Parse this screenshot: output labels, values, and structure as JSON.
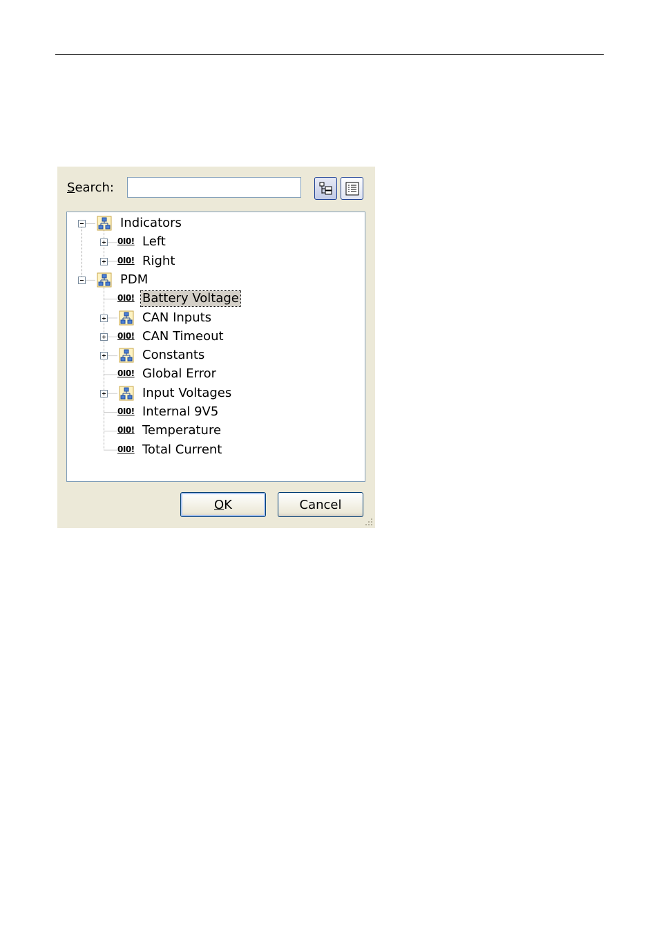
{
  "dialog": {
    "search": {
      "label_accel": "S",
      "label_rest": "earch:",
      "value": ""
    },
    "toolbar": {
      "tree_view_icon": "tree-view-icon",
      "list_view_icon": "list-view-icon"
    },
    "tree": {
      "nodes": [
        {
          "label": "Indicators",
          "icon": "group-icon",
          "expander": "minus",
          "level": 0
        },
        {
          "label": "Left",
          "icon": "binary-icon",
          "icon_text": "0I0!",
          "expander": "plus",
          "level": 1
        },
        {
          "label": "Right",
          "icon": "binary-icon",
          "icon_text": "0I0!",
          "expander": "plus",
          "level": 1
        },
        {
          "label": "PDM",
          "icon": "group-icon",
          "expander": "minus",
          "level": 0
        },
        {
          "label": "Battery Voltage",
          "icon": "binary-icon",
          "icon_text": "0I0!",
          "expander": "none",
          "level": 1,
          "selected": true
        },
        {
          "label": "CAN Inputs",
          "icon": "group-icon",
          "expander": "plus",
          "level": 1
        },
        {
          "label": "CAN Timeout",
          "icon": "binary-icon",
          "icon_text": "0I0!",
          "expander": "plus",
          "level": 1
        },
        {
          "label": "Constants",
          "icon": "group-icon",
          "expander": "plus",
          "level": 1
        },
        {
          "label": "Global Error",
          "icon": "binary-icon",
          "icon_text": "0I0!",
          "expander": "none",
          "level": 1
        },
        {
          "label": "Input Voltages",
          "icon": "group-icon",
          "expander": "plus",
          "level": 1
        },
        {
          "label": "Internal 9V5",
          "icon": "binary-icon",
          "icon_text": "0I0!",
          "expander": "none",
          "level": 1
        },
        {
          "label": "Temperature",
          "icon": "binary-icon",
          "icon_text": "0I0!",
          "expander": "none",
          "level": 1
        },
        {
          "label": "Total Current",
          "icon": "binary-icon",
          "icon_text": "0I0!",
          "expander": "none",
          "level": 1
        }
      ]
    },
    "buttons": {
      "ok_accel": "O",
      "ok_rest": "K",
      "cancel": "Cancel"
    }
  },
  "colors": {
    "dialog_bg": "#ece9d8",
    "border": "#7f9db9",
    "button_border": "#003c74"
  }
}
